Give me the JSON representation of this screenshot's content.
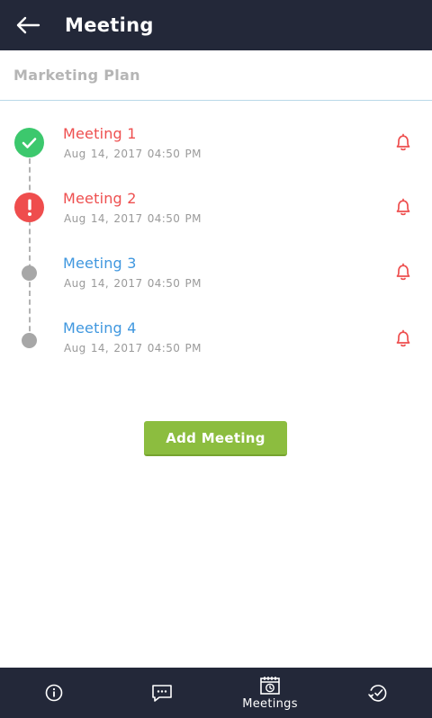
{
  "header": {
    "title": "Meeting",
    "back_icon": "arrow-left-icon"
  },
  "subtitle": "Marketing Plan",
  "meetings": [
    {
      "title": "Meeting 1",
      "date": "Aug 14, 2017",
      "time": "04:50 PM",
      "status": "done",
      "title_color": "#ee4f4f"
    },
    {
      "title": "Meeting 2",
      "date": "Aug 14, 2017",
      "time": "04:50 PM",
      "status": "alert",
      "title_color": "#ee4f4f"
    },
    {
      "title": "Meeting 3",
      "date": "Aug 14, 2017",
      "time": "04:50 PM",
      "status": "pending",
      "title_color": "#3f97df"
    },
    {
      "title": "Meeting 4",
      "date": "Aug 14, 2017",
      "time": "04:50 PM",
      "status": "pending",
      "title_color": "#3f97df"
    }
  ],
  "add_button_label": "Add Meeting",
  "nav": [
    {
      "icon": "info-icon",
      "label": ""
    },
    {
      "icon": "chat-icon",
      "label": ""
    },
    {
      "icon": "meetings-calendar-icon",
      "label": "Meetings",
      "active": true
    },
    {
      "icon": "history-icon",
      "label": ""
    }
  ],
  "colors": {
    "header_bg": "#232839",
    "done": "#3cc86d",
    "alert": "#ef4d4d",
    "pending": "#a7a7a7",
    "button": "#8cbd3f",
    "bell": "#ee4f4f"
  }
}
